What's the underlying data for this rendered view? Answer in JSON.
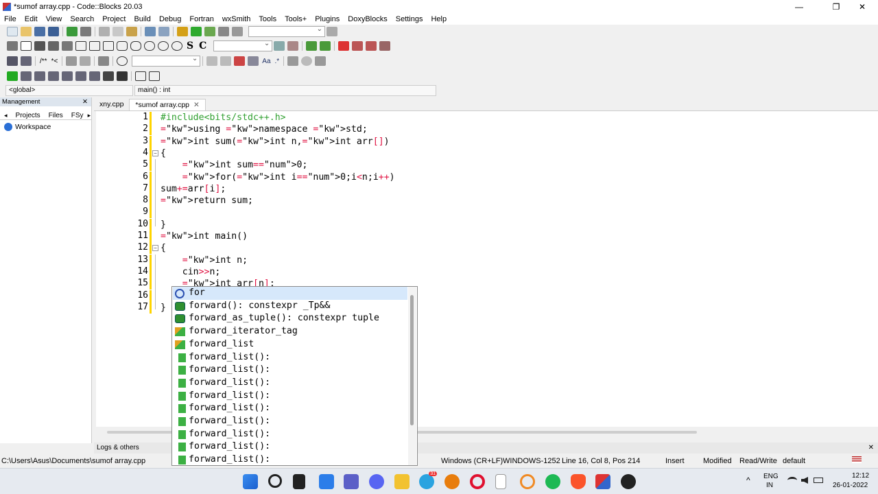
{
  "window": {
    "title": "*sumof array.cpp - Code::Blocks 20.03",
    "minimize": "—",
    "maximize": "❐",
    "close": "✕"
  },
  "menu": [
    "File",
    "Edit",
    "View",
    "Search",
    "Project",
    "Build",
    "Debug",
    "Fortran",
    "wxSmith",
    "Tools",
    "Tools+",
    "Plugins",
    "DoxyBlocks",
    "Settings",
    "Help"
  ],
  "toolbar": {
    "bold_s": "S",
    "bold_c": "C",
    "regex": "Aa",
    "star": ".*"
  },
  "scope": {
    "global": "<global>",
    "function": "main() : int"
  },
  "management": {
    "header": "Management",
    "close": "✕",
    "tabs": [
      "Projects",
      "Files",
      "FSy"
    ],
    "workspace": "Workspace"
  },
  "editor_tabs": [
    {
      "label": "xny.cpp",
      "active": false
    },
    {
      "label": "*sumof array.cpp",
      "active": true,
      "close": "✕"
    }
  ],
  "code_lines": [
    {
      "n": "1",
      "text": "#include<bits/stdc++.h>"
    },
    {
      "n": "2",
      "text": "using namespace std;"
    },
    {
      "n": "3",
      "text": "int sum(int n,int arr[])"
    },
    {
      "n": "4",
      "text": "{"
    },
    {
      "n": "5",
      "text": "    int sum=0;"
    },
    {
      "n": "6",
      "text": "    for(int i=0;i<n;i++)"
    },
    {
      "n": "7",
      "text": "sum+=arr[i];"
    },
    {
      "n": "8",
      "text": "return sum;"
    },
    {
      "n": "9",
      "text": ""
    },
    {
      "n": "10",
      "text": "}"
    },
    {
      "n": "11",
      "text": "int main()"
    },
    {
      "n": "12",
      "text": "{"
    },
    {
      "n": "13",
      "text": "    int n;"
    },
    {
      "n": "14",
      "text": "    cin>>n;"
    },
    {
      "n": "15",
      "text": "    int arr[n];"
    },
    {
      "n": "16",
      "text": ""
    },
    {
      "n": "17",
      "text": "}"
    }
  ],
  "autocomplete": [
    {
      "icon": "C+",
      "text": "for",
      "selected": true
    },
    {
      "icon": "()",
      "text": "forward(): constexpr _Tp&&"
    },
    {
      "icon": "()",
      "text": "forward_as_tuple(): constexpr tuple"
    },
    {
      "icon": "cls",
      "text": "forward_iterator_tag"
    },
    {
      "icon": "cls",
      "text": "forward_list"
    },
    {
      "icon": "fn",
      "text": "forward_list():"
    },
    {
      "icon": "fn",
      "text": "forward_list():"
    },
    {
      "icon": "fn",
      "text": "forward_list():"
    },
    {
      "icon": "fn",
      "text": "forward_list():"
    },
    {
      "icon": "fn",
      "text": "forward_list():"
    },
    {
      "icon": "fn",
      "text": "forward_list():"
    },
    {
      "icon": "fn",
      "text": "forward_list():"
    },
    {
      "icon": "fn",
      "text": "forward_list():"
    },
    {
      "icon": "fn",
      "text": "forward_list():"
    }
  ],
  "logs": {
    "label": "Logs & others",
    "close": "✕"
  },
  "status": {
    "path": "C:\\Users\\Asus\\Documents\\sumof array.cpp",
    "eol": "Windows (CR+LF)",
    "encoding": "WINDOWS-1252",
    "position": "Line 16, Col 8, Pos 214",
    "mode": "Insert",
    "modified": "Modified",
    "access": "Read/Write",
    "profile": "default"
  },
  "taskbar": {
    "lang1": "ENG",
    "lang2": "IN",
    "time": "12:12",
    "date": "26-01-2022",
    "badge": "31",
    "chevron": "^"
  }
}
